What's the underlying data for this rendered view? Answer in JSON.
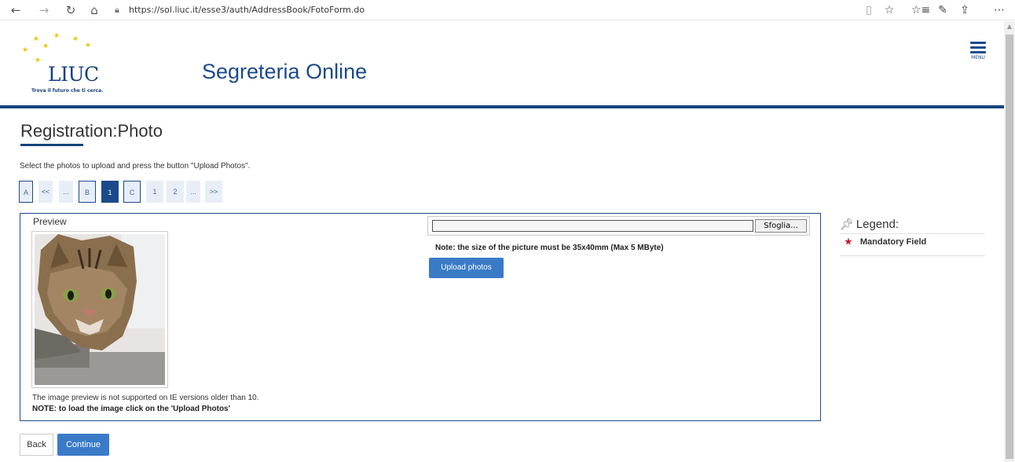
{
  "browser": {
    "url": "https://sol.liuc.it/esse3/auth/AddressBook/FotoForm.do",
    "back_icon": "←",
    "forward_icon": "→",
    "refresh_icon": "↻",
    "home_icon": "⌂",
    "reader_icon": "▯",
    "favorite_icon": "☆",
    "favorites_icon": "☆≡",
    "pen_icon": "✎",
    "share_icon": "⇪",
    "more_icon": "⋯"
  },
  "header": {
    "logo_text": "LIUC",
    "logo_tagline": "Trova il futuro che ti cerca.",
    "site_title": "Segreteria Online",
    "menu_label": "MENU"
  },
  "page": {
    "title": "Registration:Photo",
    "instructions": "Select the photos to upload and press the button \"Upload Photos\"."
  },
  "pager": {
    "items": [
      "A",
      "<<",
      "...",
      "B",
      "1",
      "C",
      "1",
      "2",
      "...",
      ">>"
    ]
  },
  "preview": {
    "label": "Preview",
    "note": "The image preview is not supported on IE versions older than 10.",
    "note_bold": "NOTE: to load the image click on the 'Upload Photos'"
  },
  "upload": {
    "browse_label": "Sfoglia...",
    "size_note": "Note: the size of the picture must be 35x40mm (Max 5 MByte)",
    "upload_label": "Upload photos"
  },
  "legend": {
    "title": "Legend:",
    "mandatory_label": "Mandatory Field"
  },
  "actions": {
    "back_label": "Back",
    "continue_label": "Continue"
  },
  "colors": {
    "brand": "#14447f",
    "button": "#3a7bc8",
    "mandatory": "#c0202a"
  }
}
